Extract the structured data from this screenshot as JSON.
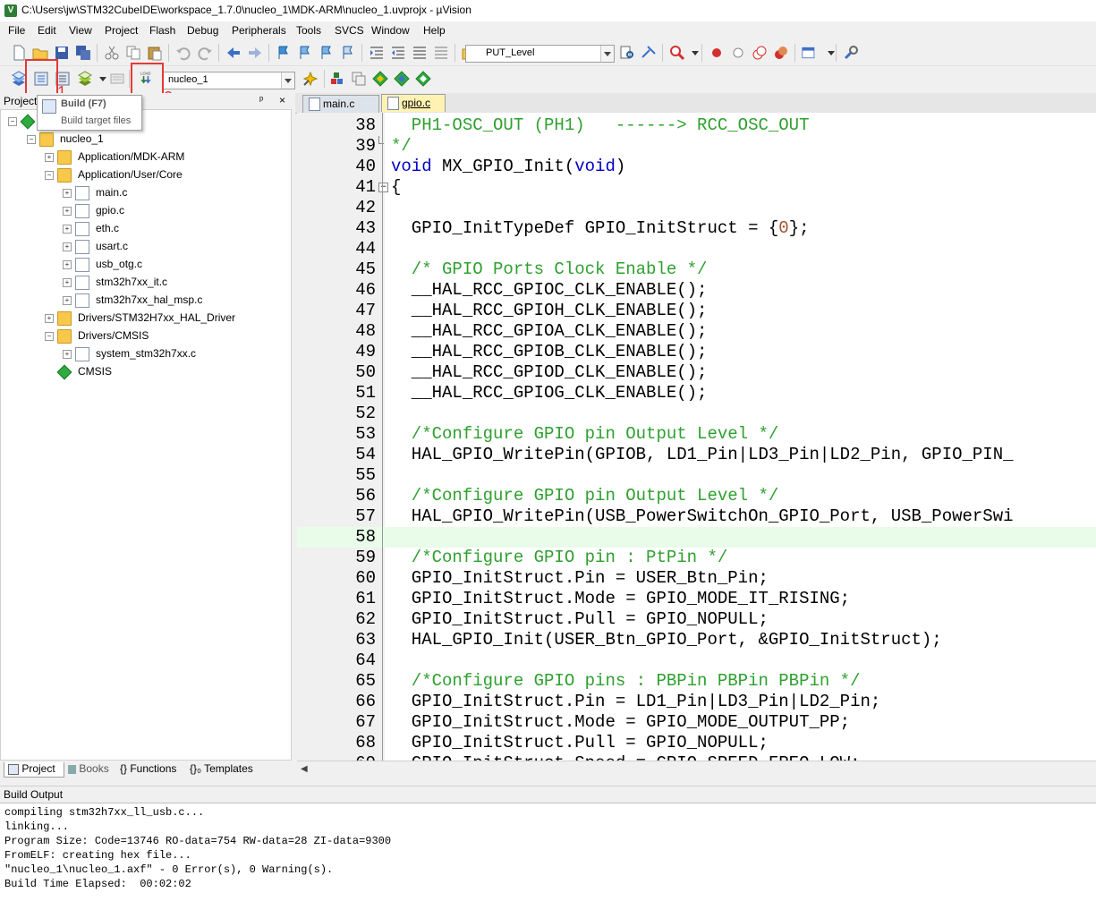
{
  "window": {
    "title": "C:\\Users\\jw\\STM32CubeIDE\\workspace_1.7.0\\nucleo_1\\MDK-ARM\\nucleo_1.uvprojx - µVision",
    "icon_letter": "V"
  },
  "menu": [
    "File",
    "Edit",
    "View",
    "Project",
    "Flash",
    "Debug",
    "Peripherals",
    "Tools",
    "SVCS",
    "Window",
    "Help"
  ],
  "toolbar": {
    "find_combo_value": "PUT_Level",
    "target_combo_value": "nucleo_1",
    "load_button_text": "LOAD",
    "annotation_1": "1",
    "annotation_2": "2"
  },
  "tooltip": {
    "title": "Build (F7)",
    "description": "Build target files"
  },
  "project_panel": {
    "title": "Project",
    "close": "×",
    "pin": "ᵖ",
    "tree": [
      {
        "label": "nucleo_1",
        "type": "folder",
        "level": 1,
        "expanded": true
      },
      {
        "label": "Application/MDK-ARM",
        "type": "folder",
        "level": 2,
        "expanded": false
      },
      {
        "label": "Application/User/Core",
        "type": "folder",
        "level": 2,
        "expanded": true
      },
      {
        "label": "main.c",
        "type": "file",
        "level": 3
      },
      {
        "label": "gpio.c",
        "type": "file",
        "level": 3
      },
      {
        "label": "eth.c",
        "type": "file",
        "level": 3
      },
      {
        "label": "usart.c",
        "type": "file",
        "level": 3
      },
      {
        "label": "usb_otg.c",
        "type": "file",
        "level": 3
      },
      {
        "label": "stm32h7xx_it.c",
        "type": "file",
        "level": 3
      },
      {
        "label": "stm32h7xx_hal_msp.c",
        "type": "file",
        "level": 3
      },
      {
        "label": "Drivers/STM32H7xx_HAL_Driver",
        "type": "folder",
        "level": 2,
        "expanded": false
      },
      {
        "label": "Drivers/CMSIS",
        "type": "folder",
        "level": 2,
        "expanded": true
      },
      {
        "label": "system_stm32h7xx.c",
        "type": "file",
        "level": 3
      },
      {
        "label": "CMSIS",
        "type": "component",
        "level": 2
      }
    ],
    "tabs": [
      "Project",
      "Books",
      "{} Functions",
      "{}₀ Templates"
    ]
  },
  "editor": {
    "tabs": [
      {
        "label": "main.c",
        "active": false
      },
      {
        "label": "gpio.c",
        "active": true
      }
    ],
    "lines": [
      {
        "n": "38",
        "fold": "",
        "parts": [
          {
            "t": "  PH1-OSC_OUT (PH1)   ------> RCC_OSC_OUT",
            "c": "green"
          }
        ]
      },
      {
        "n": "39",
        "fold": "end",
        "parts": [
          {
            "t": "*/",
            "c": "green"
          }
        ]
      },
      {
        "n": "40",
        "fold": "",
        "parts": [
          {
            "t": "void",
            "c": "blue"
          },
          {
            "t": " MX_GPIO_Init(",
            "c": ""
          },
          {
            "t": "void",
            "c": "blue"
          },
          {
            "t": ")",
            "c": ""
          }
        ]
      },
      {
        "n": "41",
        "fold": "minus",
        "parts": [
          {
            "t": "{",
            "c": ""
          }
        ]
      },
      {
        "n": "42",
        "fold": "",
        "parts": [
          {
            "t": "",
            "c": ""
          }
        ]
      },
      {
        "n": "43",
        "fold": "",
        "parts": [
          {
            "t": "  GPIO_InitTypeDef GPIO_InitStruct = {",
            "c": ""
          },
          {
            "t": "0",
            "c": "num"
          },
          {
            "t": "};",
            "c": ""
          }
        ]
      },
      {
        "n": "44",
        "fold": "",
        "parts": [
          {
            "t": "",
            "c": ""
          }
        ]
      },
      {
        "n": "45",
        "fold": "",
        "parts": [
          {
            "t": "  /* GPIO Ports Clock Enable */",
            "c": "green"
          }
        ]
      },
      {
        "n": "46",
        "fold": "",
        "parts": [
          {
            "t": "  __HAL_RCC_GPIOC_CLK_ENABLE();",
            "c": ""
          }
        ]
      },
      {
        "n": "47",
        "fold": "",
        "parts": [
          {
            "t": "  __HAL_RCC_GPIOH_CLK_ENABLE();",
            "c": ""
          }
        ]
      },
      {
        "n": "48",
        "fold": "",
        "parts": [
          {
            "t": "  __HAL_RCC_GPIOA_CLK_ENABLE();",
            "c": ""
          }
        ]
      },
      {
        "n": "49",
        "fold": "",
        "parts": [
          {
            "t": "  __HAL_RCC_GPIOB_CLK_ENABLE();",
            "c": ""
          }
        ]
      },
      {
        "n": "50",
        "fold": "",
        "parts": [
          {
            "t": "  __HAL_RCC_GPIOD_CLK_ENABLE();",
            "c": ""
          }
        ]
      },
      {
        "n": "51",
        "fold": "",
        "parts": [
          {
            "t": "  __HAL_RCC_GPIOG_CLK_ENABLE();",
            "c": ""
          }
        ]
      },
      {
        "n": "52",
        "fold": "",
        "parts": [
          {
            "t": "",
            "c": ""
          }
        ]
      },
      {
        "n": "53",
        "fold": "",
        "parts": [
          {
            "t": "  /*Configure GPIO pin Output Level */",
            "c": "green"
          }
        ]
      },
      {
        "n": "54",
        "fold": "",
        "parts": [
          {
            "t": "  HAL_GPIO_WritePin(GPIOB, LD1_Pin|LD3_Pin|LD2_Pin, GPIO_PIN_",
            "c": ""
          }
        ]
      },
      {
        "n": "55",
        "fold": "",
        "parts": [
          {
            "t": "",
            "c": ""
          }
        ]
      },
      {
        "n": "56",
        "fold": "",
        "parts": [
          {
            "t": "  /*Configure GPIO pin Output Level */",
            "c": "green"
          }
        ]
      },
      {
        "n": "57",
        "fold": "",
        "parts": [
          {
            "t": "  HAL_GPIO_WritePin(USB_PowerSwitchOn_GPIO_Port, USB_PowerSwi",
            "c": ""
          }
        ]
      },
      {
        "n": "58",
        "fold": "",
        "hl": true,
        "parts": [
          {
            "t": "",
            "c": ""
          }
        ]
      },
      {
        "n": "59",
        "fold": "",
        "parts": [
          {
            "t": "  /*Configure GPIO pin : PtPin */",
            "c": "green"
          }
        ]
      },
      {
        "n": "60",
        "fold": "",
        "parts": [
          {
            "t": "  GPIO_InitStruct.Pin = USER_Btn_Pin;",
            "c": ""
          }
        ]
      },
      {
        "n": "61",
        "fold": "",
        "parts": [
          {
            "t": "  GPIO_InitStruct.Mode = GPIO_MODE_IT_RISING;",
            "c": ""
          }
        ]
      },
      {
        "n": "62",
        "fold": "",
        "parts": [
          {
            "t": "  GPIO_InitStruct.Pull = GPIO_NOPULL;",
            "c": ""
          }
        ]
      },
      {
        "n": "63",
        "fold": "",
        "parts": [
          {
            "t": "  HAL_GPIO_Init(USER_Btn_GPIO_Port, &GPIO_InitStruct);",
            "c": ""
          }
        ]
      },
      {
        "n": "64",
        "fold": "",
        "parts": [
          {
            "t": "",
            "c": ""
          }
        ]
      },
      {
        "n": "65",
        "fold": "",
        "parts": [
          {
            "t": "  /*Configure GPIO pins : PBPin PBPin PBPin */",
            "c": "green"
          }
        ]
      },
      {
        "n": "66",
        "fold": "",
        "parts": [
          {
            "t": "  GPIO_InitStruct.Pin = LD1_Pin|LD3_Pin|LD2_Pin;",
            "c": ""
          }
        ]
      },
      {
        "n": "67",
        "fold": "",
        "parts": [
          {
            "t": "  GPIO_InitStruct.Mode = GPIO_MODE_OUTPUT_PP;",
            "c": ""
          }
        ]
      },
      {
        "n": "68",
        "fold": "",
        "parts": [
          {
            "t": "  GPIO_InitStruct.Pull = GPIO_NOPULL;",
            "c": ""
          }
        ]
      },
      {
        "n": "69",
        "fold": "",
        "parts": [
          {
            "t": "  GPIO_InitStruct.Speed = GPIO_SPEED_FREQ_LOW;",
            "c": ""
          }
        ]
      }
    ]
  },
  "build_output": {
    "title": "Build Output",
    "lines": [
      "compiling stm32h7xx_ll_usb.c...",
      "linking...",
      "Program Size: Code=13746 RO-data=754 RW-data=28 ZI-data=9300",
      "FromELF: creating hex file...",
      "\"nucleo_1\\nucleo_1.axf\" - 0 Error(s), 0 Warning(s).",
      "Build Time Elapsed:  00:02:02"
    ]
  },
  "colors": {
    "comment": "#2ea02e",
    "keyword": "#0000c8",
    "number": "#a0522d",
    "highlight_line": "#e9fbe9",
    "annotation_red": "#e53935"
  }
}
